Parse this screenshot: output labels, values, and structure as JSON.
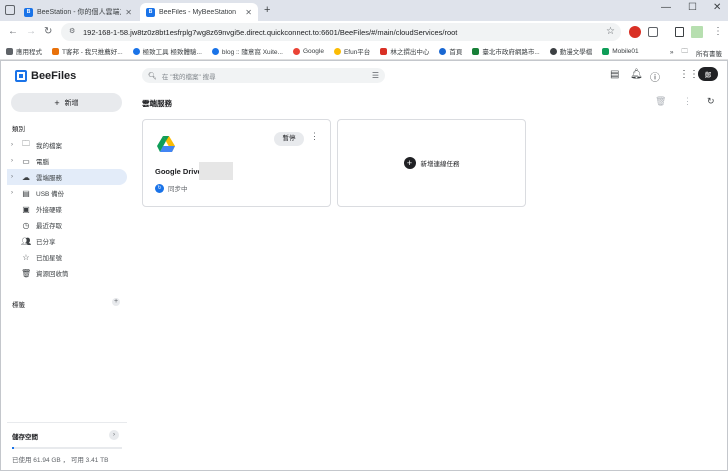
{
  "browser": {
    "tabs": [
      {
        "title": "BeeStation - 你的個人雲端之旅",
        "active": false
      },
      {
        "title": "BeeFiles - MyBeeStation",
        "active": true
      }
    ],
    "url": "192-168-1-58.jw8tz0z8bt1esfrplg7wg8z69nvgi5e.direct.quickconnect.to:6601/BeeFiles/#/main/cloudServices/root",
    "bookmarks": [
      "應用程式",
      "T客邦 - 我只推薦好...",
      "極致工具 極致體驗...",
      "blog :: 隨意窩 Xuite...",
      "Google",
      "Efun平台",
      "林之撰出中心",
      "首頁",
      "臺北市政府網路市...",
      "動漫文學檔",
      "Mobile01"
    ],
    "bookmarks_folder": "所有書籤"
  },
  "app": {
    "name": "BeeFiles",
    "search_placeholder": "在 \"我的檔案\" 搜尋",
    "avatar_initial": "鄭",
    "new_button": "新增",
    "category_label": "類別",
    "nav": [
      {
        "label": "我的檔案",
        "icon": "folder-icon",
        "chevron": true,
        "active": false
      },
      {
        "label": "電腦",
        "icon": "computer-icon",
        "chevron": true,
        "active": false
      },
      {
        "label": "雲端服務",
        "icon": "cloud-icon",
        "chevron": true,
        "active": true
      },
      {
        "label": "USB 備份",
        "icon": "usb-icon",
        "chevron": true,
        "active": false
      },
      {
        "label": "外接硬碟",
        "icon": "drive-icon",
        "chevron": false,
        "active": false
      },
      {
        "label": "最近存取",
        "icon": "clock-icon",
        "chevron": false,
        "active": false
      },
      {
        "label": "已分享",
        "icon": "people-icon",
        "chevron": false,
        "active": false
      },
      {
        "label": "已加星號",
        "icon": "star-icon",
        "chevron": false,
        "active": false
      },
      {
        "label": "資源回收筒",
        "icon": "trash-icon",
        "chevron": false,
        "active": false
      }
    ],
    "tags_label": "標籤",
    "storage": {
      "title": "儲存空間",
      "used_text": "已使用 61.94 GB ， 可用 3.41 TB",
      "used_fraction": 0.018
    },
    "main_title": "雲端服務",
    "service_card": {
      "name": "Google Drive",
      "pause_label": "暫停",
      "status": "同步中"
    },
    "add_card_label": "新增連線任務"
  }
}
